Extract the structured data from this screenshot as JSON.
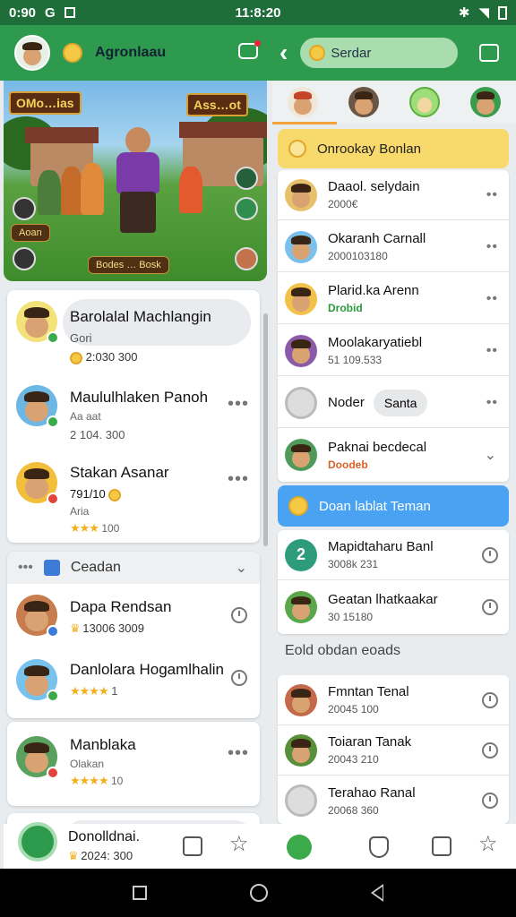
{
  "status_bar": {
    "time": "0:90",
    "center_time": "11:8:20"
  },
  "app_bar": {
    "title": "Agronlaau",
    "search_label": "Serdar"
  },
  "banner": {
    "sign_left": "OMo…ias",
    "sign_right": "Ass…ot",
    "label": "Aoan",
    "button": "Bodes … Bosk"
  },
  "left_list_1": [
    {
      "name": "Barolalal Machlangin",
      "sub": "Gori",
      "meta": "2:030 300"
    },
    {
      "name": "Maululhlaken Panoh",
      "sub": "Aa aat",
      "meta": "2 104. 300"
    },
    {
      "name": "Stakan Asanar",
      "sub": "791/10",
      "sub2": "Aria",
      "meta": "100"
    }
  ],
  "left_section": {
    "title": "Ceadan"
  },
  "left_list_2": [
    {
      "name": "Dapa Rendsan",
      "meta": "13006 3009"
    },
    {
      "name": "Danlolara Hogamlhalin",
      "meta": "1"
    }
  ],
  "left_list_3": [
    {
      "name": "Manblaka",
      "sub": "Olakan",
      "meta": "10"
    },
    {
      "name": "Donolldnai.",
      "meta": "2024: 300"
    }
  ],
  "right_header_1": "Onrookay Bonlan",
  "right_list_1": [
    {
      "name": "Daaol. selydain",
      "sub": "2000€"
    },
    {
      "name": "Okaranh Carnall",
      "sub": "2000103180"
    },
    {
      "name": "Plarid.ka Arenn",
      "sub": "Drobid"
    },
    {
      "name": "Moolakaryatiebl",
      "sub": "51 109.533"
    },
    {
      "name": "Noder",
      "sub": "Santa"
    },
    {
      "name": "Paknai becdecal",
      "sub": "Doodeb"
    }
  ],
  "right_header_2": "Doan lablat Teman",
  "right_list_2": [
    {
      "name": "Mapidtaharu Banl",
      "sub": "3008k 231"
    },
    {
      "name": "Geatan lhatkaakar",
      "sub": "30 15180"
    }
  ],
  "right_section_label": "Eold obdan eoads",
  "right_list_3": [
    {
      "name": "Fmntan Tenal",
      "sub": "20045 100"
    },
    {
      "name": "Toiaran Tanak",
      "sub": "20043 210"
    },
    {
      "name": "Terahao Ranal",
      "sub": "20068 360"
    }
  ],
  "colors": {
    "primary": "#2d9a4e",
    "header_yellow": "#f8d96b",
    "header_blue": "#4aa3f2"
  }
}
